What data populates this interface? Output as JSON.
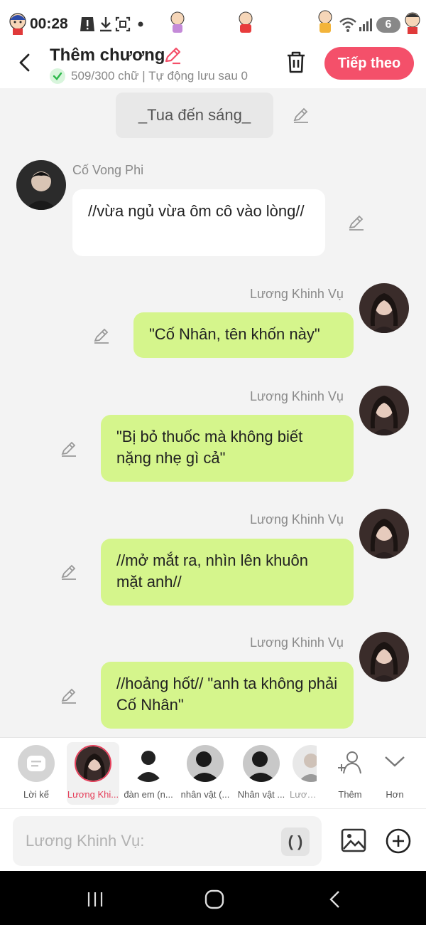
{
  "status_bar": {
    "time": "00:28",
    "badge": "6"
  },
  "header": {
    "title": "Thêm chương",
    "subtitle": "509/300 chữ | Tự động lưu sau 0",
    "next_label": "Tiếp theo"
  },
  "chat": {
    "narration": "_Tua đến sáng_",
    "messages": [
      {
        "speaker": "Cố Vong Phi",
        "text": "//vừa ngủ vừa ôm cô vào lòng//",
        "side": "left"
      },
      {
        "speaker": "Lương Khinh Vụ",
        "text": "\"Cố Nhân, tên khốn này\"",
        "side": "right"
      },
      {
        "speaker": "Lương Khinh Vụ",
        "text": "\"Bị bỏ thuốc mà không biết nặng nhẹ gì cả\"",
        "side": "right"
      },
      {
        "speaker": "Lương Khinh Vụ",
        "text": "//mở mắt ra, nhìn lên khuôn mặt anh//",
        "side": "right"
      },
      {
        "speaker": "Lương Khinh Vụ",
        "text": "//hoảng hốt// \"anh ta không phải Cố Nhân\"",
        "side": "right"
      }
    ]
  },
  "characters": {
    "items": [
      {
        "label": "Lời kể"
      },
      {
        "label": "Lương Khi..."
      },
      {
        "label": "đàn em (n..."
      },
      {
        "label": "nhân vật (..."
      },
      {
        "label": "Nhân vật ..."
      },
      {
        "label": "Lương"
      }
    ],
    "add_label": "Thêm",
    "more_label": "Hơn"
  },
  "input": {
    "placeholder": "Lương Khinh Vụ:",
    "paren_label": "( )"
  },
  "colors": {
    "accent": "#f4506a",
    "bubble_green": "#d5f58c",
    "bubble_white": "#ffffff",
    "check_green": "#2db84b"
  }
}
